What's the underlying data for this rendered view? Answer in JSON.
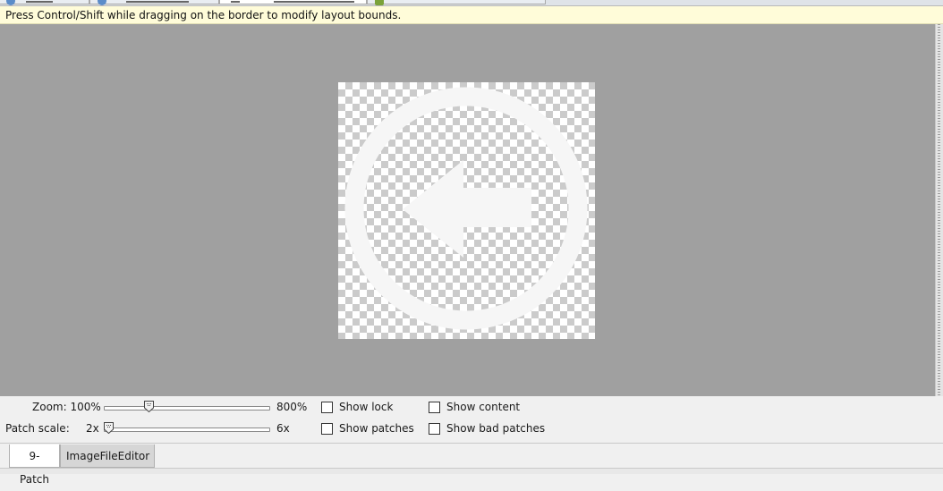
{
  "hint": {
    "text": "Press Control/Shift while dragging on the border to modify layout bounds."
  },
  "image": {
    "icon": "arrow-left-circle-icon",
    "color": "#f6f6f6"
  },
  "zoom": {
    "label": "Zoom: 100%",
    "max_label": "800%",
    "value": 0.26
  },
  "patch_scale": {
    "label": "Patch scale:",
    "min_label": "2x",
    "max_label": "6x",
    "value": 0.0
  },
  "options": {
    "show_lock": "Show lock",
    "show_content": "Show content",
    "show_patches": "Show patches",
    "show_bad_patches": "Show bad patches"
  },
  "tabs": {
    "ninepatch": "9-Patch",
    "imagefileeditor": "ImageFileEditor"
  }
}
